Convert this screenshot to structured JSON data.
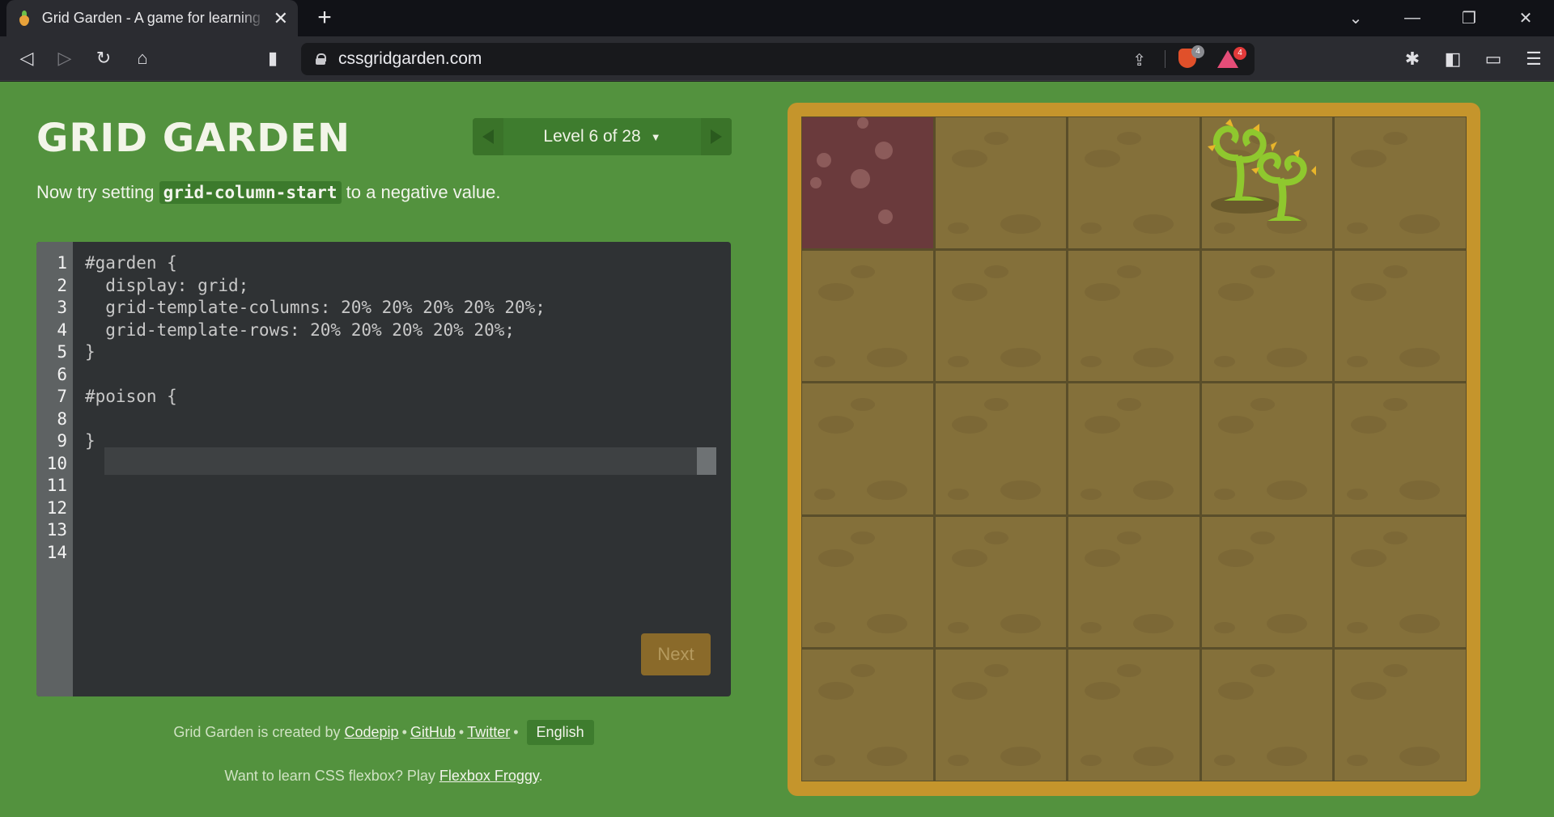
{
  "browser": {
    "tab_title": "Grid Garden - A game for learning CSS grid",
    "close_glyph": "✕",
    "new_tab_glyph": "+",
    "url": "cssgridgarden.com",
    "shields_count": "4",
    "rewards_count": "4"
  },
  "header": {
    "logo": "GRID GARDEN",
    "level_label": "Level 6 of 28",
    "level_caret": "▼"
  },
  "instructions": {
    "before": "Now try setting ",
    "code": "grid-column-start",
    "after": " to a negative value."
  },
  "editor": {
    "line_numbers": [
      "1",
      "2",
      "3",
      "4",
      "5",
      "6",
      "7",
      "8",
      "9",
      "10",
      "11",
      "12",
      "13",
      "14"
    ],
    "lines": [
      "#garden {",
      "  display: grid;",
      "  grid-template-columns: 20% 20% 20% 20% 20%;",
      "  grid-template-rows: 20% 20% 20% 20% 20%;",
      "}",
      "",
      "#poison {",
      "",
      "}"
    ],
    "input_value": "",
    "next_label": "Next"
  },
  "footer": {
    "created_by": "Grid Garden is created by ",
    "codepip": "Codepip",
    "sep": "•",
    "github": "GitHub",
    "twitter": "Twitter",
    "language": "English",
    "flexbox_text": "Want to learn CSS flexbox? Play ",
    "flexbox_link": "Flexbox Froggy",
    "flexbox_end": "."
  },
  "garden": {
    "rows": 5,
    "columns": 5,
    "poison_cell": [
      1,
      1
    ],
    "crops_cell": [
      1,
      4
    ],
    "colors": {
      "soil": "#84703a",
      "poison": "#6a3a3c",
      "border": "#c5952c",
      "page": "#53923e"
    }
  }
}
